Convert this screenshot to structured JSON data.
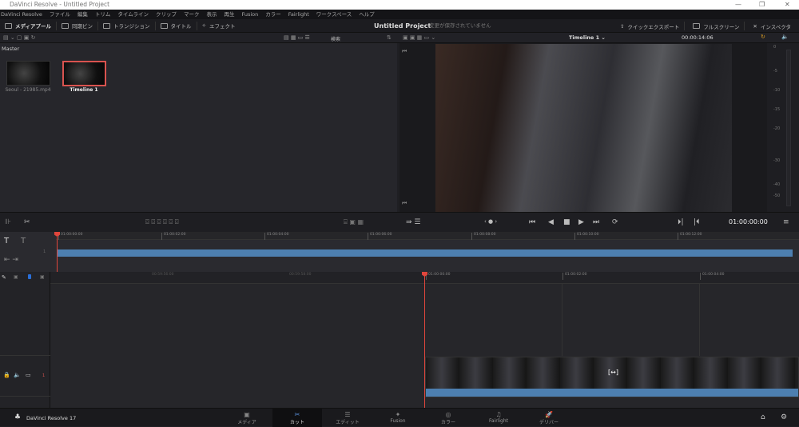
{
  "window": {
    "title": "DaVinci Resolve - Untitled Project",
    "minimize": "—",
    "maximize": "❐",
    "close": "✕"
  },
  "menu": [
    "DaVinci Resolve",
    "ファイル",
    "編集",
    "トリム",
    "タイムライン",
    "クリップ",
    "マーク",
    "表示",
    "再生",
    "Fusion",
    "カラー",
    "Fairlight",
    "ワークスペース",
    "ヘルプ"
  ],
  "toolbar": {
    "media_pool": "メディアプール",
    "sync_bin": "同期ビン",
    "transitions": "トランジション",
    "titles": "タイトル",
    "effects": "エフェクト",
    "project_title": "Untitled Project",
    "unsaved": "変更が保存されていません",
    "quick_export": "クイックエクスポート",
    "fullscreen": "フルスクリーン",
    "inspector": "インスペクタ"
  },
  "pool": {
    "search": "検索",
    "bin": "Master",
    "clips": [
      {
        "name": "Seoul - 21985.mp4"
      },
      {
        "name": "Timeline 1"
      }
    ]
  },
  "viewer": {
    "timeline_name": "Timeline 1 ⌄",
    "duration": "00:00:14:06",
    "timecode": "01:00:00:00"
  },
  "meter": {
    "labels": [
      "0",
      "-5",
      "-10",
      "-15",
      "-20",
      "-30",
      "-40",
      "-50"
    ]
  },
  "upper_ruler": [
    "01:00:00:00",
    "01:00:02:00",
    "01:00:04:00",
    "01:00:06:00",
    "01:00:08:00",
    "01:00:10:00",
    "01:00:12:00"
  ],
  "lower_ruler": [
    "00:59:56:00",
    "00:59:58:00",
    "01:00:00:00",
    "01:00:02:00",
    "01:00:04:00"
  ],
  "track": {
    "number": "1",
    "upper_number": "1"
  },
  "bottom": {
    "app": "DaVinci Resolve 17",
    "pages": [
      {
        "label": "メディア",
        "icon": "▣"
      },
      {
        "label": "カット",
        "icon": "✂"
      },
      {
        "label": "エディット",
        "icon": "☰"
      },
      {
        "label": "Fusion",
        "icon": "✦"
      },
      {
        "label": "カラー",
        "icon": "◎"
      },
      {
        "label": "Fairlight",
        "icon": "♫"
      },
      {
        "label": "デリバー",
        "icon": "🚀"
      }
    ],
    "active": 1
  }
}
